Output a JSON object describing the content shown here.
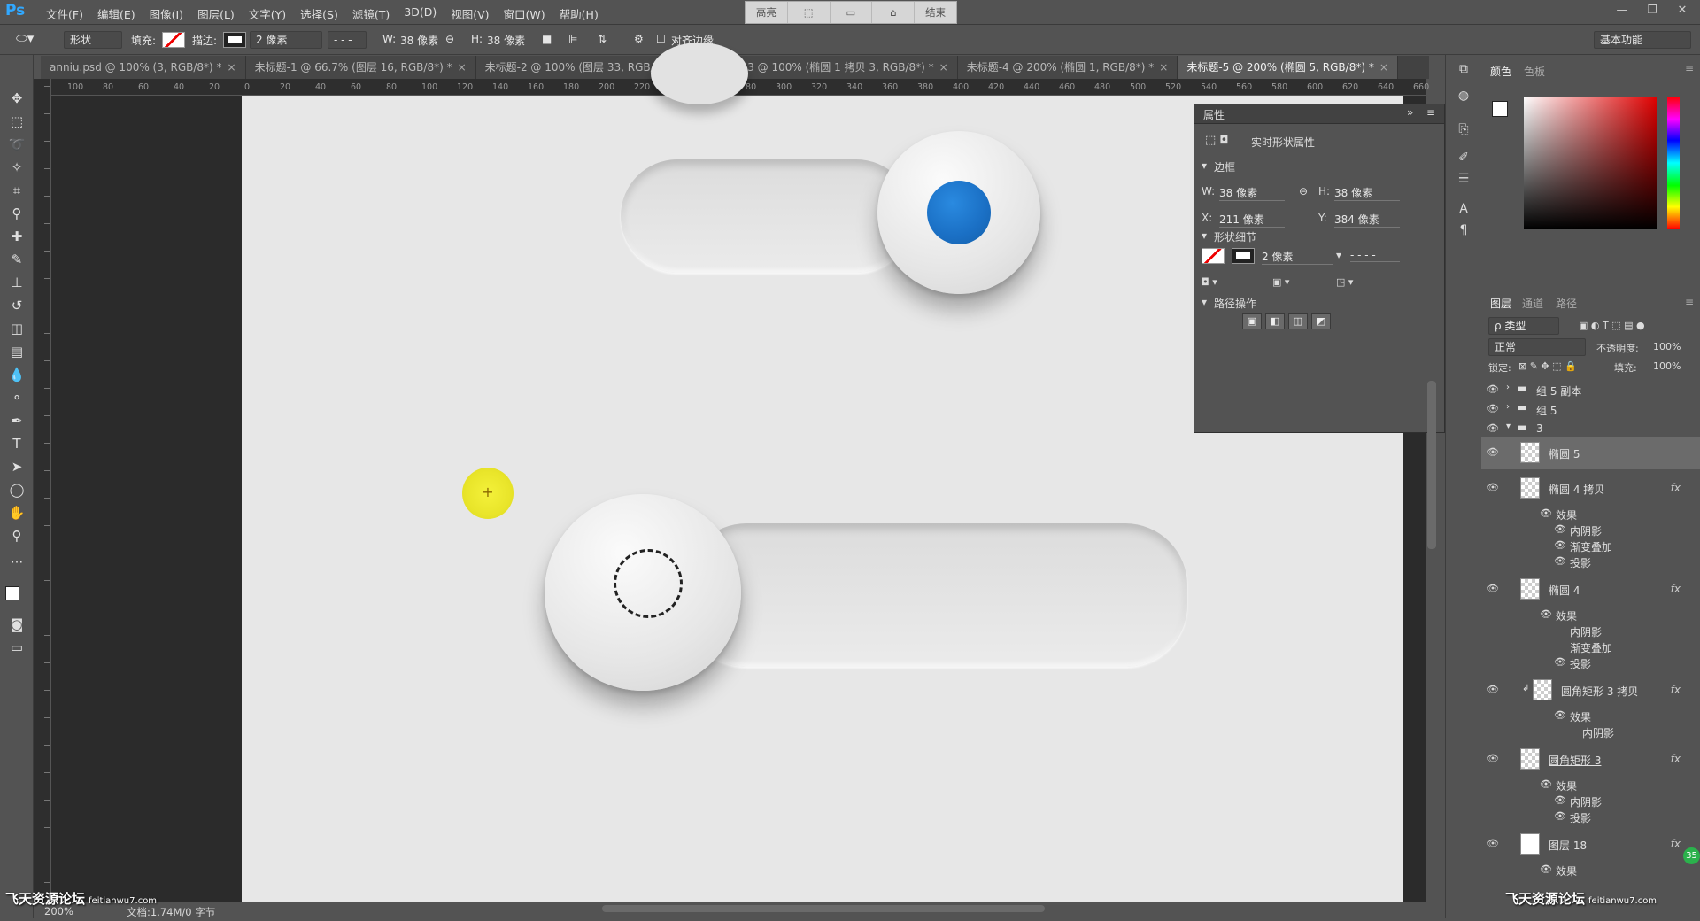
{
  "app": {
    "logo": "Ps"
  },
  "menu": [
    "文件(F)",
    "编辑(E)",
    "图像(I)",
    "图层(L)",
    "文字(Y)",
    "选择(S)",
    "滤镜(T)",
    "3D(D)",
    "视图(V)",
    "窗口(W)",
    "帮助(H)"
  ],
  "view_toolbar": [
    "高亮",
    "",
    "",
    "",
    "结束"
  ],
  "options": {
    "mode_select": "形状",
    "fill_label": "填充:",
    "stroke_label": "描边:",
    "stroke_width": "2 像素",
    "width_label": "W:",
    "width_value": "38 像素",
    "height_label": "H:",
    "height_value": "38 像素",
    "align_edges": "对齐边缘",
    "workspace": "基本功能"
  },
  "tabs": [
    {
      "label": "anniu.psd @ 100% (3, RGB/8*) *",
      "active": false
    },
    {
      "label": "未标题-1 @ 66.7% (图层 16, RGB/8*) *",
      "active": false
    },
    {
      "label": "未标题-2 @ 100% (图层 33, RGB/8*) *",
      "active": false
    },
    {
      "label": "未标题-3 @ 100% (椭圆 1 拷贝 3, RGB/8*) *",
      "active": false
    },
    {
      "label": "未标题-4 @ 200% (椭圆 1, RGB/8*) *",
      "active": false
    },
    {
      "label": "未标题-5 @ 200% (椭圆 5, RGB/8*) *",
      "active": true
    }
  ],
  "ruler_top": [
    "100",
    "80",
    "60",
    "40",
    "20",
    "0",
    "20",
    "40",
    "60",
    "80",
    "100",
    "120",
    "140",
    "160",
    "180",
    "200",
    "220",
    "240",
    "260",
    "280",
    "300",
    "320",
    "340",
    "360",
    "380",
    "400",
    "420",
    "440",
    "460",
    "480",
    "500",
    "520",
    "540",
    "560",
    "580",
    "600",
    "620",
    "640",
    "660"
  ],
  "properties": {
    "title": "属性",
    "shape_props": "实时形状属性",
    "section_bounds": "边框",
    "w_label": "W:",
    "w_value": "38 像素",
    "h_label": "H:",
    "h_value": "38 像素",
    "x_label": "X:",
    "x_value": "211 像素",
    "y_label": "Y:",
    "y_value": "384 像素",
    "section_shape": "形状细节",
    "stroke_size": "2 像素",
    "section_path": "路径操作"
  },
  "color_panel": {
    "tab_color": "颜色",
    "tab_swatch": "色板",
    "accent": "#1a73c8"
  },
  "layers_panel": {
    "tab_layers": "图层",
    "tab_channels": "通道",
    "tab_paths": "路径",
    "filter": "ρ 类型",
    "blend_mode": "正常",
    "opacity_label": "不透明度:",
    "opacity_value": "100%",
    "lock_label": "锁定:",
    "fill_label": "填充:",
    "fill_value": "100%",
    "layers": [
      {
        "name": "组 5 副本"
      },
      {
        "name": "组 5"
      },
      {
        "name": "3"
      },
      {
        "name": "椭圆 5"
      },
      {
        "name": "椭圆 4 拷贝"
      },
      {
        "name": "效果"
      },
      {
        "name": "内阴影"
      },
      {
        "name": "渐变叠加"
      },
      {
        "name": "投影"
      },
      {
        "name": "椭圆 4"
      },
      {
        "name": "效果"
      },
      {
        "name": "内阴影"
      },
      {
        "name": "渐变叠加"
      },
      {
        "name": "投影"
      },
      {
        "name": "圆角矩形 3 拷贝"
      },
      {
        "name": "效果"
      },
      {
        "name": "内阴影"
      },
      {
        "name": "圆角矩形 3"
      },
      {
        "name": "效果"
      },
      {
        "name": "内阴影"
      },
      {
        "name": "投影"
      },
      {
        "name": "图层 18"
      },
      {
        "name": "效果"
      }
    ]
  },
  "status": {
    "zoom": "200%",
    "doc": "文档:1.74M/0 字节"
  },
  "watermark": {
    "left": "飞天资源论坛",
    "right": "飞天资源论坛",
    "sub": "feitianwu7.com",
    "badge": "35"
  }
}
